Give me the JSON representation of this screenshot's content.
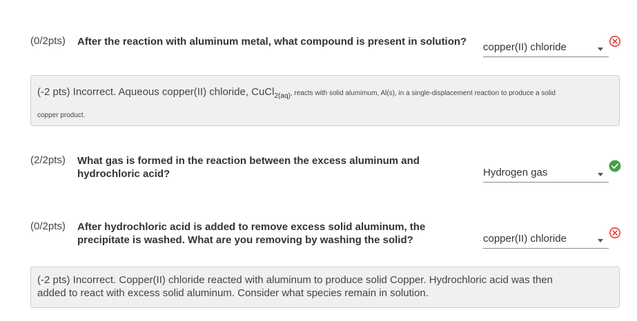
{
  "questions": [
    {
      "score": "(0/2pts)",
      "prompt": "After the reaction with aluminum metal, what compound is present in solution?",
      "selected": "copper(II) chloride",
      "status": "incorrect",
      "feedback": {
        "main": "(-2 pts) Incorrect. Aqueous copper(II) chloride, CuCl",
        "sub1": "2",
        "sub2": "(aq)",
        "small1": ", reacts with solid alumimum, Al(s), in a single-displacement reaction to produce a solid",
        "small2": "copper product."
      }
    },
    {
      "score": "(2/2pts)",
      "prompt_line1": "What gas is formed in the reaction between the excess aluminum and",
      "prompt_line2": "hydrochloric acid?",
      "selected": "Hydrogen gas",
      "status": "correct"
    },
    {
      "score": "(0/2pts)",
      "prompt_line1": "After hydrochloric acid is added to remove excess solid aluminum, the",
      "prompt_line2": "precipitate is washed. What are you removing by washing the solid?",
      "selected": "copper(II) chloride",
      "status": "incorrect",
      "feedback": {
        "line1": "(-2 pts) Incorrect. Copper(II) chloride reacted with aluminum to produce solid Copper. Hydrochloric acid was then",
        "line2": "added to react with excess solid aluminum. Consider what species remain in solution."
      }
    }
  ],
  "colors": {
    "incorrect": "#e53935",
    "correct": "#43a047",
    "feedback_bg": "#f0f0f0"
  },
  "icons": {
    "incorrect": "x-circle-icon",
    "correct": "check-circle-icon",
    "dropdown": "caret-down-icon"
  }
}
